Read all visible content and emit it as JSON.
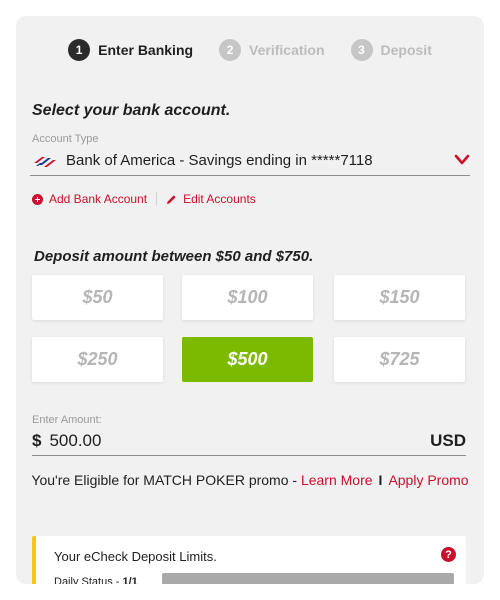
{
  "stepper": {
    "steps": [
      {
        "number": "1",
        "label": "Enter Banking",
        "state": "active"
      },
      {
        "number": "2",
        "label": "Verification",
        "state": "inactive"
      },
      {
        "number": "3",
        "label": "Deposit",
        "state": "inactive"
      }
    ]
  },
  "bank_section": {
    "title": "Select your bank account.",
    "account_type_label": "Account Type",
    "selected_account": "Bank of America - Savings ending in *****7118",
    "bank_logo_icon": "bank-of-america-flag-icon",
    "add_bank_account": "Add Bank Account",
    "edit_accounts": "Edit Accounts"
  },
  "deposit_section": {
    "title": "Deposit amount between $50 and $750.",
    "amount_options": [
      "$50",
      "$100",
      "$150",
      "$250",
      "$500",
      "$725"
    ],
    "selected_amount": "$500",
    "enter_amount_label": "Enter Amount:",
    "currency_symbol": "$",
    "amount_value": "500.00",
    "currency_code": "USD"
  },
  "promo": {
    "text": "You're Eligible for MATCH POKER promo - ",
    "learn_more": "Learn More",
    "separator": "I",
    "apply_promo": "Apply Promo"
  },
  "limits": {
    "title": "Your eCheck Deposit Limits.",
    "help_icon": "?",
    "daily_status_label": "Daily Status - ",
    "daily_status_value": "1/1"
  },
  "colors": {
    "accent_red": "#c8102e",
    "selected_green": "#7cba00",
    "limits_border": "#f5c518"
  }
}
